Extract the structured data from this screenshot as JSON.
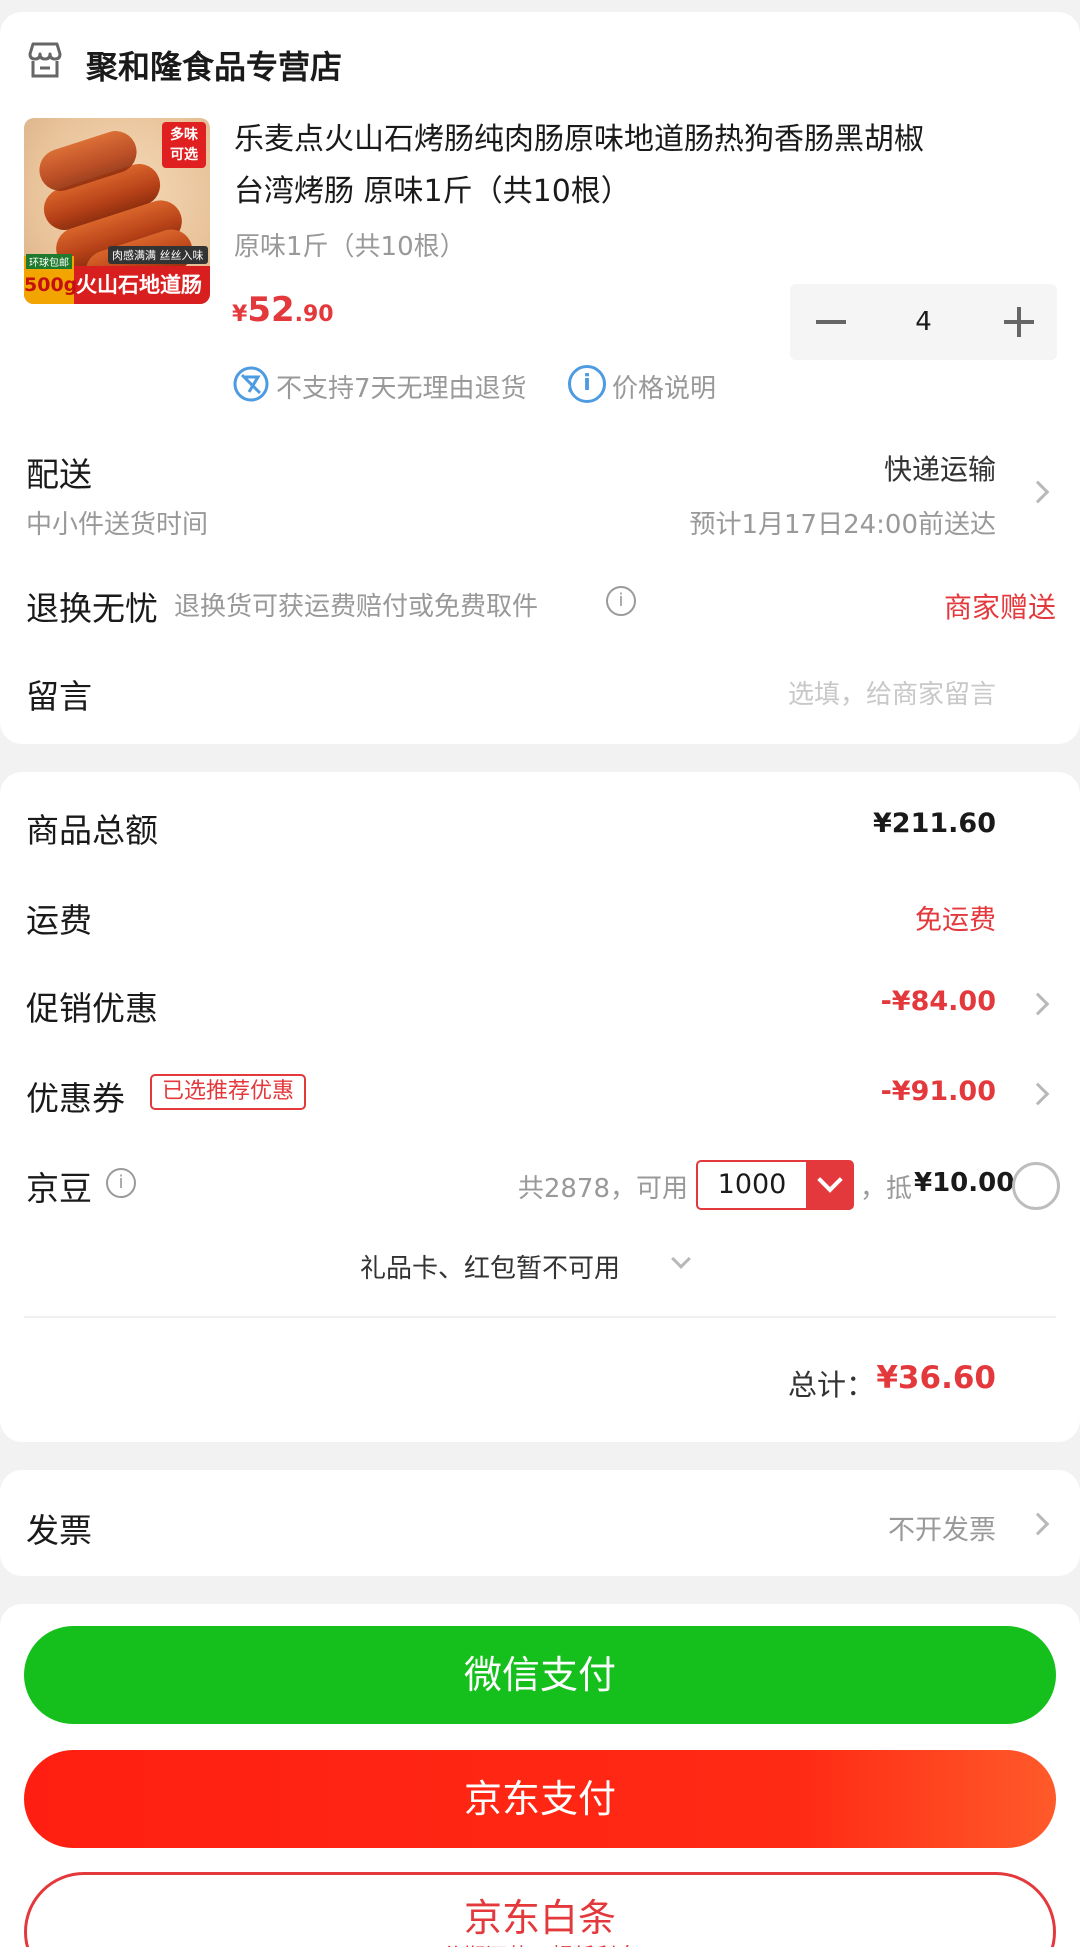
{
  "store": {
    "name": "聚和隆食品专营店",
    "icon": "store-icon"
  },
  "product": {
    "title_line1": "乐麦点火山石烤肠纯肉肠原味地道肠热狗香肠黑胡椒",
    "title_line2": "台湾烤肠 原味1斤（共10根）",
    "spec": "原味1斤（共10根）",
    "price_symbol": "¥",
    "price_int": "52",
    "price_dec": ".90",
    "quantity": "4",
    "thumb_tag": "多味\n可选",
    "thumb_strip": "火山石地道肠",
    "thumb_weight": "500g",
    "thumb_note": "肉感满满 丝丝入味",
    "thumb_top": "环球包邮",
    "no_return": "不支持7天无理由退货",
    "price_note": "价格说明"
  },
  "delivery": {
    "label": "配送",
    "sub": "中小件送货时间",
    "method": "快递运输",
    "eta": "预计1月17日24:00前送达"
  },
  "exchange": {
    "label": "退换无忧",
    "desc": "退换货可获运费赔付或免费取件",
    "value": "商家赠送"
  },
  "message": {
    "label": "留言",
    "placeholder": "选填，给商家留言"
  },
  "totals": {
    "goods_label": "商品总额",
    "goods_value": "¥211.60",
    "shipping_label": "运费",
    "shipping_value": "免运费",
    "promo_label": "促销优惠",
    "promo_value": "-¥84.00",
    "coupon_label": "优惠券",
    "coupon_tag": "已选推荐优惠",
    "coupon_value": "-¥91.00",
    "beans_label": "京豆",
    "beans_total": "共2878，可用",
    "beans_selected": "1000",
    "beans_deduct_prefix": "，抵",
    "beans_deduct": "¥10.00",
    "gift_note": "礼品卡、红包暂不可用",
    "total_label": "总计：",
    "total_value": "¥36.60"
  },
  "invoice": {
    "label": "发票",
    "value": "不开发票"
  },
  "payment": {
    "wechat": "微信支付",
    "jd": "京东支付",
    "baitiao": "京东白条",
    "baitiao_sub": "分期还款 · 超低利息"
  },
  "colors": {
    "accent_red": "#e4393c",
    "wechat_green": "#15c01c",
    "jd_red": "#ff1f12"
  }
}
